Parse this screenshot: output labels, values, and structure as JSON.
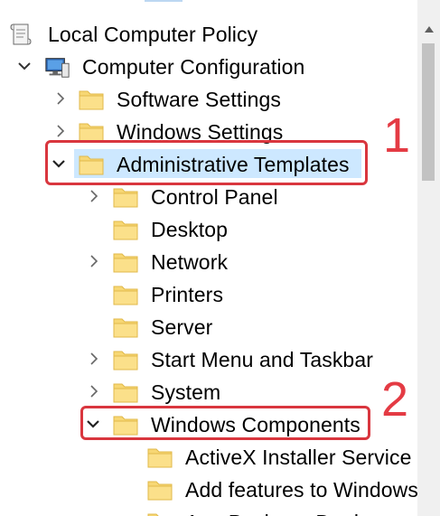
{
  "tree": {
    "root": {
      "label": "Local Computer Policy",
      "icon": "policy-scroll-icon"
    },
    "computer_config": {
      "label": "Computer Configuration",
      "icon": "computer-icon"
    },
    "software_settings": {
      "label": "Software Settings",
      "icon": "folder-icon"
    },
    "windows_settings": {
      "label": "Windows Settings",
      "icon": "folder-icon"
    },
    "admin_templates": {
      "label": "Administrative Templates",
      "icon": "folder-icon",
      "selected": true
    },
    "control_panel": {
      "label": "Control Panel",
      "icon": "folder-icon"
    },
    "desktop": {
      "label": "Desktop",
      "icon": "folder-icon"
    },
    "network": {
      "label": "Network",
      "icon": "folder-icon"
    },
    "printers": {
      "label": "Printers",
      "icon": "folder-icon"
    },
    "server": {
      "label": "Server",
      "icon": "folder-icon"
    },
    "start_menu": {
      "label": "Start Menu and Taskbar",
      "icon": "folder-icon"
    },
    "system": {
      "label": "System",
      "icon": "folder-icon"
    },
    "windows_components": {
      "label": "Windows Components",
      "icon": "folder-icon"
    },
    "activex": {
      "label": "ActiveX Installer Service",
      "icon": "folder-icon"
    },
    "add_features": {
      "label": "Add features to Windows",
      "icon": "folder-icon"
    },
    "app_package": {
      "label": "App Package Deployment",
      "icon": "folder-icon"
    }
  },
  "annotations": {
    "step1": "1",
    "step2": "2"
  },
  "colors": {
    "selection": "#cde8ff",
    "annotation_red": "#d9363e",
    "folder_yellow": "#f7d774",
    "folder_edge": "#e0b84a"
  }
}
